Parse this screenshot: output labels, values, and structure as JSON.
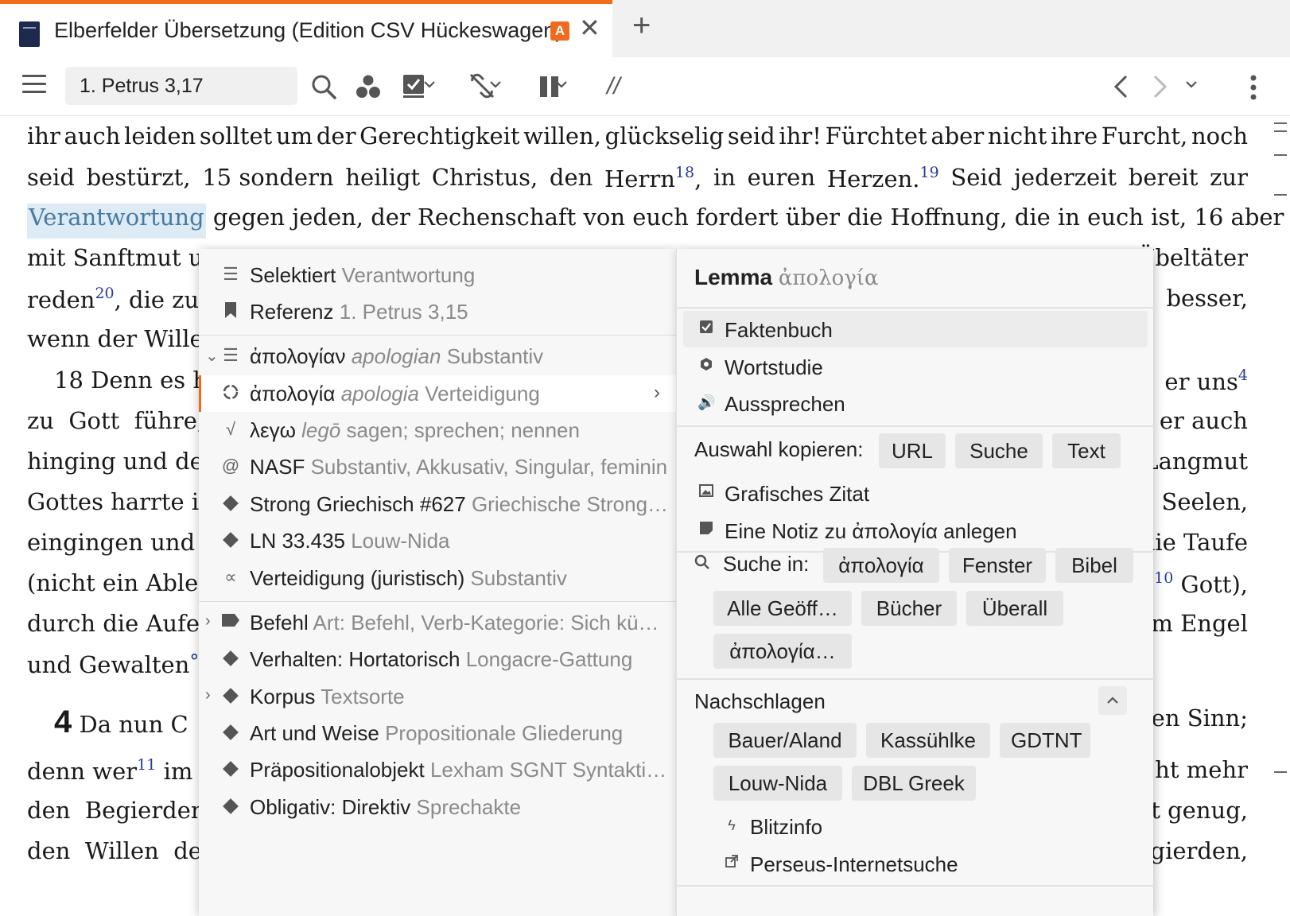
{
  "tab": {
    "title": "Elberfelder Übersetzung (Edition CSV Hückeswagen)",
    "badge": "A",
    "close": "✕",
    "new_tab": "+"
  },
  "toolbar": {
    "reference": "1. Petrus 3,17",
    "parallel": "//"
  },
  "bible_text": {
    "l1": [
      "ihr",
      "auch",
      "leiden",
      "solltet",
      "um",
      "der",
      "Gerechtigkeit",
      "willen,",
      "glückselig",
      "seid",
      "ihr!",
      "Fürchtet",
      "aber",
      "nicht",
      "ihre",
      "Furcht,",
      "noch"
    ],
    "l2": {
      "a": "seid",
      "b": "bestürzt,",
      "c": "15",
      "d": "sondern",
      "e": "heiligt",
      "f": "Christus,",
      "g": "den",
      "h": "Herrn",
      "sup1": "18",
      "i": ",",
      "j": "in",
      "k": "euren",
      "l": "Herzen.",
      "sup2": "19",
      "m": "Seid",
      "n": "jederzeit",
      "o": "bereit",
      "p": "zur"
    },
    "l3": {
      "sel": "Verantwortung",
      "rest": "gegen jeden, der Rechenschaft von euch fordert über die Hoffnung, die in euch ist, 16 aber"
    },
    "l4": {
      "left": "mit Sanftmut u",
      "right": "Übeltäter"
    },
    "l5": {
      "left": "reden",
      "sup": "20",
      "left2": ", die zu",
      "right": "besser,"
    },
    "l6": {
      "left": "wenn der Wille",
      "right": ""
    },
    "l7": {
      "left": "18 Denn es h",
      "right": "er uns",
      "sup": "4"
    },
    "l8": {
      "left": "zu  Gott  führe,",
      "right": "er auch"
    },
    "l9": {
      "left": "hinging und de",
      "right": "Langmut"
    },
    "l10": {
      "left": "Gottes harrte in",
      "right": "Seelen,"
    },
    "l11": {
      "left": "eingingen und d",
      "right": "die Taufe"
    },
    "l12": {
      "left": "(nicht ein Able",
      "sup": "10",
      "right": "Gott),"
    },
    "l13": {
      "left": "durch die Aufer",
      "right": "m Engel"
    },
    "l14": {
      "left": "und Gewalten",
      "mark": "°",
      "right": ""
    },
    "l15": {
      "chap": "4",
      "left": "Da nun C",
      "right": "en Sinn;"
    },
    "l16": {
      "left": "denn wer",
      "sup": "11",
      "left2": "im",
      "right": "ht mehr"
    },
    "l17": {
      "left": "den  Begierden",
      "right": "t genug,"
    },
    "l18": {
      "left": "den  Willen  de",
      "right": "gierden,"
    }
  },
  "context_menu": {
    "items": [
      {
        "label": "Selektiert",
        "sub": "Verantwortung"
      },
      {
        "label": "Referenz",
        "sub": "1. Petrus 3,15"
      },
      {
        "label": "ἀπολογίαν",
        "it": "apologian",
        "sub": "Substantiv"
      },
      {
        "label": "ἀπολογία",
        "it": "apologia",
        "sub": "Verteidigung"
      },
      {
        "label": "λεγω",
        "it": "legō",
        "sub": "sagen; sprechen; nennen"
      },
      {
        "label": "NASF",
        "sub": "Substantiv, Akkusativ, Singular, feminin"
      },
      {
        "label": "Strong Griechisch #627",
        "sub": "Griechische Strong…"
      },
      {
        "label": "LN 33.435",
        "sub": "Louw-Nida"
      },
      {
        "label": "Verteidigung (juristisch)",
        "sub": "Substantiv"
      },
      {
        "label": "Befehl",
        "sub": "Art: Befehl, Verb-Kategorie: Sich kü…"
      },
      {
        "label": "Verhalten: Hortatorisch",
        "sub": "Longacre-Gattung"
      },
      {
        "label": "Korpus",
        "sub": "Textsorte"
      },
      {
        "label": "Art und Weise",
        "sub": "Propositionale Gliederung"
      },
      {
        "label": "Präpositionalobjekt",
        "sub": "Lexham SGNT Syntakti…"
      },
      {
        "label": "Obligativ: Direktiv",
        "sub": "Sprechakte"
      }
    ]
  },
  "lemma_panel": {
    "title": "Lemma",
    "lemma": "ἀπολογία",
    "actions": [
      "Faktenbuch",
      "Wortstudie",
      "Aussprechen"
    ],
    "copy_label": "Auswahl kopieren:",
    "copy_options": [
      "URL",
      "Suche",
      "Text"
    ],
    "graphic_quote": "Grafisches Zitat",
    "note": "Eine Notiz zu ἀπολογία anlegen",
    "search_label": "Suche in:",
    "search_options": [
      "ἀπολογία",
      "Fenster",
      "Bibel",
      "Alle Geöff…",
      "Bücher",
      "Überall",
      "ἀπολογία…"
    ],
    "lookup_label": "Nachschlagen",
    "lookup_options": [
      "Bauer/Aland",
      "Kassühlke",
      "GDTNT",
      "Louw-Nida",
      "DBL Greek"
    ],
    "blitzinfo": "Blitzinfo",
    "perseus": "Perseus-Internetsuche"
  },
  "colors": {
    "accent": "#f26a1b",
    "selection": "#dcebf5",
    "footnote": "#2a3b9a"
  }
}
